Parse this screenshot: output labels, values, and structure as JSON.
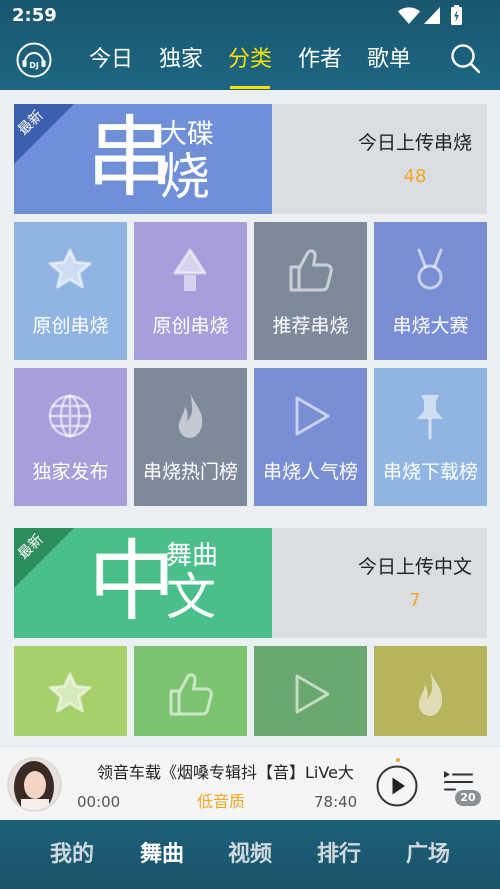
{
  "status_bar": {
    "time": "2:59",
    "icons": [
      "wifi-icon",
      "signal-icon",
      "battery-icon"
    ]
  },
  "header": {
    "logo_icon": "dj-headphones-logo-icon",
    "logo_text": "DJ",
    "tabs": [
      {
        "label": "今日",
        "active": false
      },
      {
        "label": "独家",
        "active": false
      },
      {
        "label": "分类",
        "active": true
      },
      {
        "label": "作者",
        "active": false
      },
      {
        "label": "歌单",
        "active": false
      }
    ],
    "search_icon": "search-icon",
    "active_color": "#f7e300"
  },
  "sections": [
    {
      "banner": {
        "ribbon": "最新",
        "title_main": "串",
        "title_top": "大碟",
        "title_bottom": "烧",
        "stat_label": "今日上传串烧",
        "stat_value": "48",
        "color": "#6f8fd8",
        "ribbon_color": "#3d60ae"
      },
      "tiles": [
        {
          "label": "原创串烧",
          "icon": "star-icon",
          "color": "#91b5e3"
        },
        {
          "label": "原创串烧",
          "icon": "tree-icon",
          "color": "#a99ddb"
        },
        {
          "label": "推荐串烧",
          "icon": "thumbs-up-icon",
          "color": "#7e8a9b"
        },
        {
          "label": "串烧大赛",
          "icon": "medal-icon",
          "color": "#7a8ed6"
        },
        {
          "label": "独家发布",
          "icon": "globe-icon",
          "color": "#a99ddb"
        },
        {
          "label": "串烧热门榜",
          "icon": "flame-icon",
          "color": "#7e8a9b"
        },
        {
          "label": "串烧人气榜",
          "icon": "play-icon",
          "color": "#7a8ed6"
        },
        {
          "label": "串烧下载榜",
          "icon": "pin-icon",
          "color": "#91b5e3"
        }
      ]
    },
    {
      "banner": {
        "ribbon": "最新",
        "title_main": "中",
        "title_top": "舞曲",
        "title_bottom": "文",
        "stat_label": "今日上传中文",
        "stat_value": "7",
        "color": "#4bbf8b",
        "ribbon_color": "#2e8d5c"
      },
      "tiles": [
        {
          "icon": "star-icon",
          "color": "#a6d06c"
        },
        {
          "icon": "thumbs-up-icon",
          "color": "#7cc470"
        },
        {
          "icon": "play-icon",
          "color": "#6ba770"
        },
        {
          "icon": "flame-icon",
          "color": "#b6b45d"
        }
      ]
    }
  ],
  "player": {
    "cover": "singer-avatar",
    "title": "领音车载《烟嗓专辑抖【音】LiVe大",
    "current_time": "00:00",
    "quality": "低音质",
    "duration": "78:40",
    "play_icon": "play-button-icon",
    "playlist_icon": "playlist-icon",
    "playlist_count": "20",
    "quality_color": "#f5a623"
  },
  "bottom_nav": {
    "items": [
      {
        "label": "我的",
        "active": false
      },
      {
        "label": "舞曲",
        "active": true
      },
      {
        "label": "视频",
        "active": false
      },
      {
        "label": "排行",
        "active": false
      },
      {
        "label": "广场",
        "active": false
      }
    ]
  },
  "colors": {
    "header_bg": "#1b5d77",
    "content_bg": "#edf0f2",
    "stat_value": "#f5a623",
    "banner_right_bg": "#d9dee2"
  }
}
